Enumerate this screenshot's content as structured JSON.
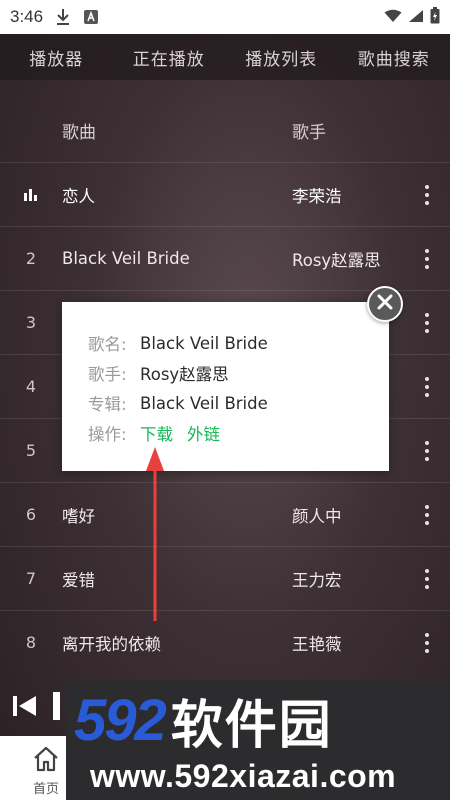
{
  "status_bar": {
    "time": "3:46"
  },
  "tabs": [
    {
      "label": "播放器"
    },
    {
      "label": "正在播放"
    },
    {
      "label": "播放列表"
    },
    {
      "label": "歌曲搜索"
    }
  ],
  "list": {
    "header": {
      "title": "歌曲",
      "artist": "歌手"
    },
    "rows": [
      {
        "index": "",
        "title": "恋人",
        "artist": "李荣浩",
        "playing": true
      },
      {
        "index": "2",
        "title": "Black Veil Bride",
        "artist": "Rosy赵露思"
      },
      {
        "index": "3",
        "title": "",
        "artist": ""
      },
      {
        "index": "4",
        "title": "",
        "artist": ""
      },
      {
        "index": "5",
        "title": "",
        "artist": ""
      },
      {
        "index": "6",
        "title": "嗜好",
        "artist": "颜人中"
      },
      {
        "index": "7",
        "title": "爱错",
        "artist": "王力宏"
      },
      {
        "index": "8",
        "title": "离开我的依赖",
        "artist": "王艳薇"
      }
    ]
  },
  "popup": {
    "name_label": "歌名:",
    "name_value": "Black Veil Bride",
    "singer_label": "歌手:",
    "singer_value": "Rosy赵露思",
    "album_label": "专辑:",
    "album_value": "Black Veil Bride",
    "action_label": "操作:",
    "download": "下载",
    "external_link": "外链"
  },
  "bottom_nav": {
    "home_label": "首页"
  },
  "watermark": {
    "number": "592",
    "brand": "软件园",
    "url": "www.592xiazai.com"
  },
  "colors": {
    "accent_green": "#18b957",
    "watermark_blue": "#2a5bd7",
    "arrow_red": "#e8413c"
  }
}
